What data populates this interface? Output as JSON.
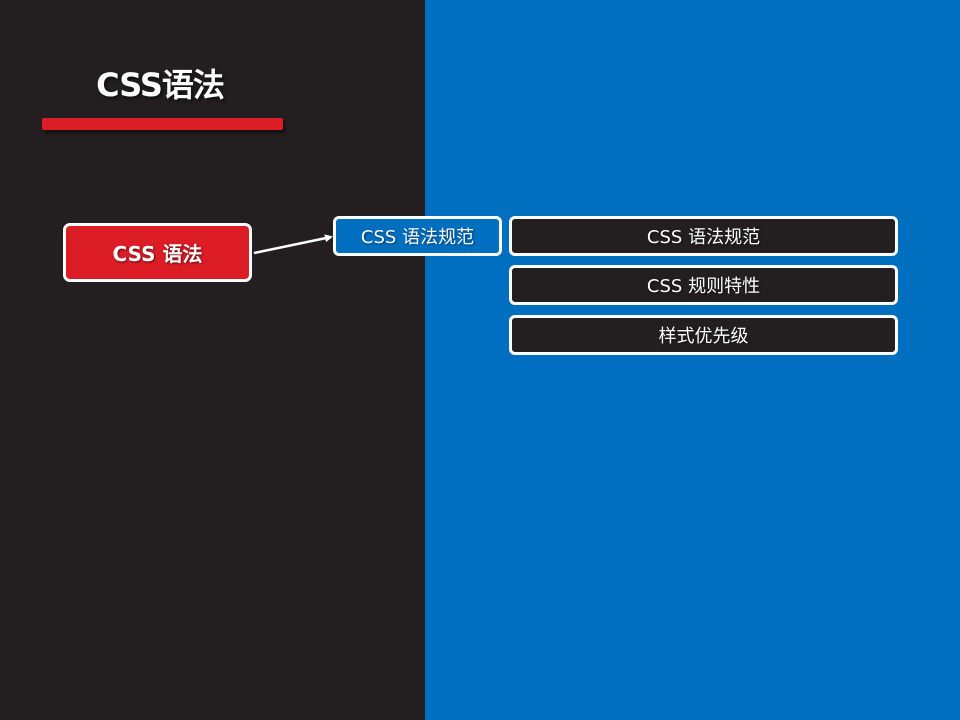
{
  "slide": {
    "title": "CSS语法",
    "main_node_label": "CSS 语法",
    "sub_node_label": "CSS 语法规范",
    "topics": [
      {
        "label": "CSS 语法规范"
      },
      {
        "label": "CSS 规则特性"
      },
      {
        "label": "样式优先级"
      }
    ]
  },
  "colors": {
    "left_background": "#231f20",
    "right_background": "#006fc0",
    "accent_red": "#dd1d26",
    "border_white": "#ffffff"
  }
}
